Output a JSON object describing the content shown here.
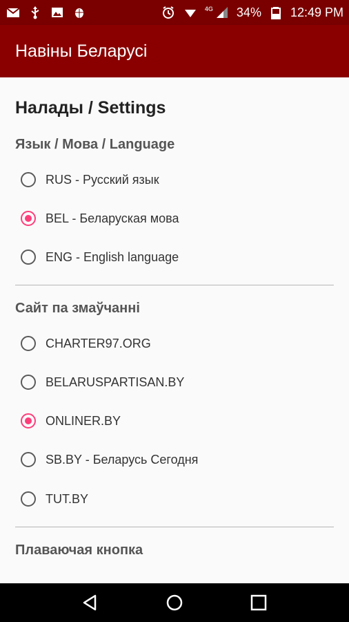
{
  "status_bar": {
    "battery_percent": "34%",
    "time": "12:49 PM",
    "network_label": "4G",
    "icons": [
      "gmail-icon",
      "usb-icon",
      "image-icon",
      "android-debug-icon",
      "alarm-icon",
      "wifi-icon",
      "signal-icon",
      "battery-icon"
    ]
  },
  "app_bar": {
    "title": "Навіны Беларусі"
  },
  "settings": {
    "title": "Налады / Settings",
    "language_section": {
      "title": "Язык / Мова / Language",
      "options": [
        {
          "label": "RUS - Русский язык",
          "checked": false
        },
        {
          "label": "BEL - Беларуская мова",
          "checked": true
        },
        {
          "label": "ENG - English language",
          "checked": false
        }
      ]
    },
    "site_section": {
      "title": "Сайт па змаўчанні",
      "options": [
        {
          "label": "CHARTER97.ORG",
          "checked": false
        },
        {
          "label": "BELARUSPARTISAN.BY",
          "checked": false
        },
        {
          "label": "ONLINER.BY",
          "checked": true
        },
        {
          "label": "SB.BY - Беларусь Сегодня",
          "checked": false
        },
        {
          "label": "TUT.BY",
          "checked": false
        }
      ]
    },
    "floating_section": {
      "title": "Плаваючая кнопка"
    }
  },
  "colors": {
    "status_bar": "#7a0000",
    "app_bar": "#8a0000",
    "accent": "#ff3d7a"
  },
  "nav_bar": {
    "icons": [
      "back-icon",
      "home-icon",
      "recents-icon"
    ]
  }
}
